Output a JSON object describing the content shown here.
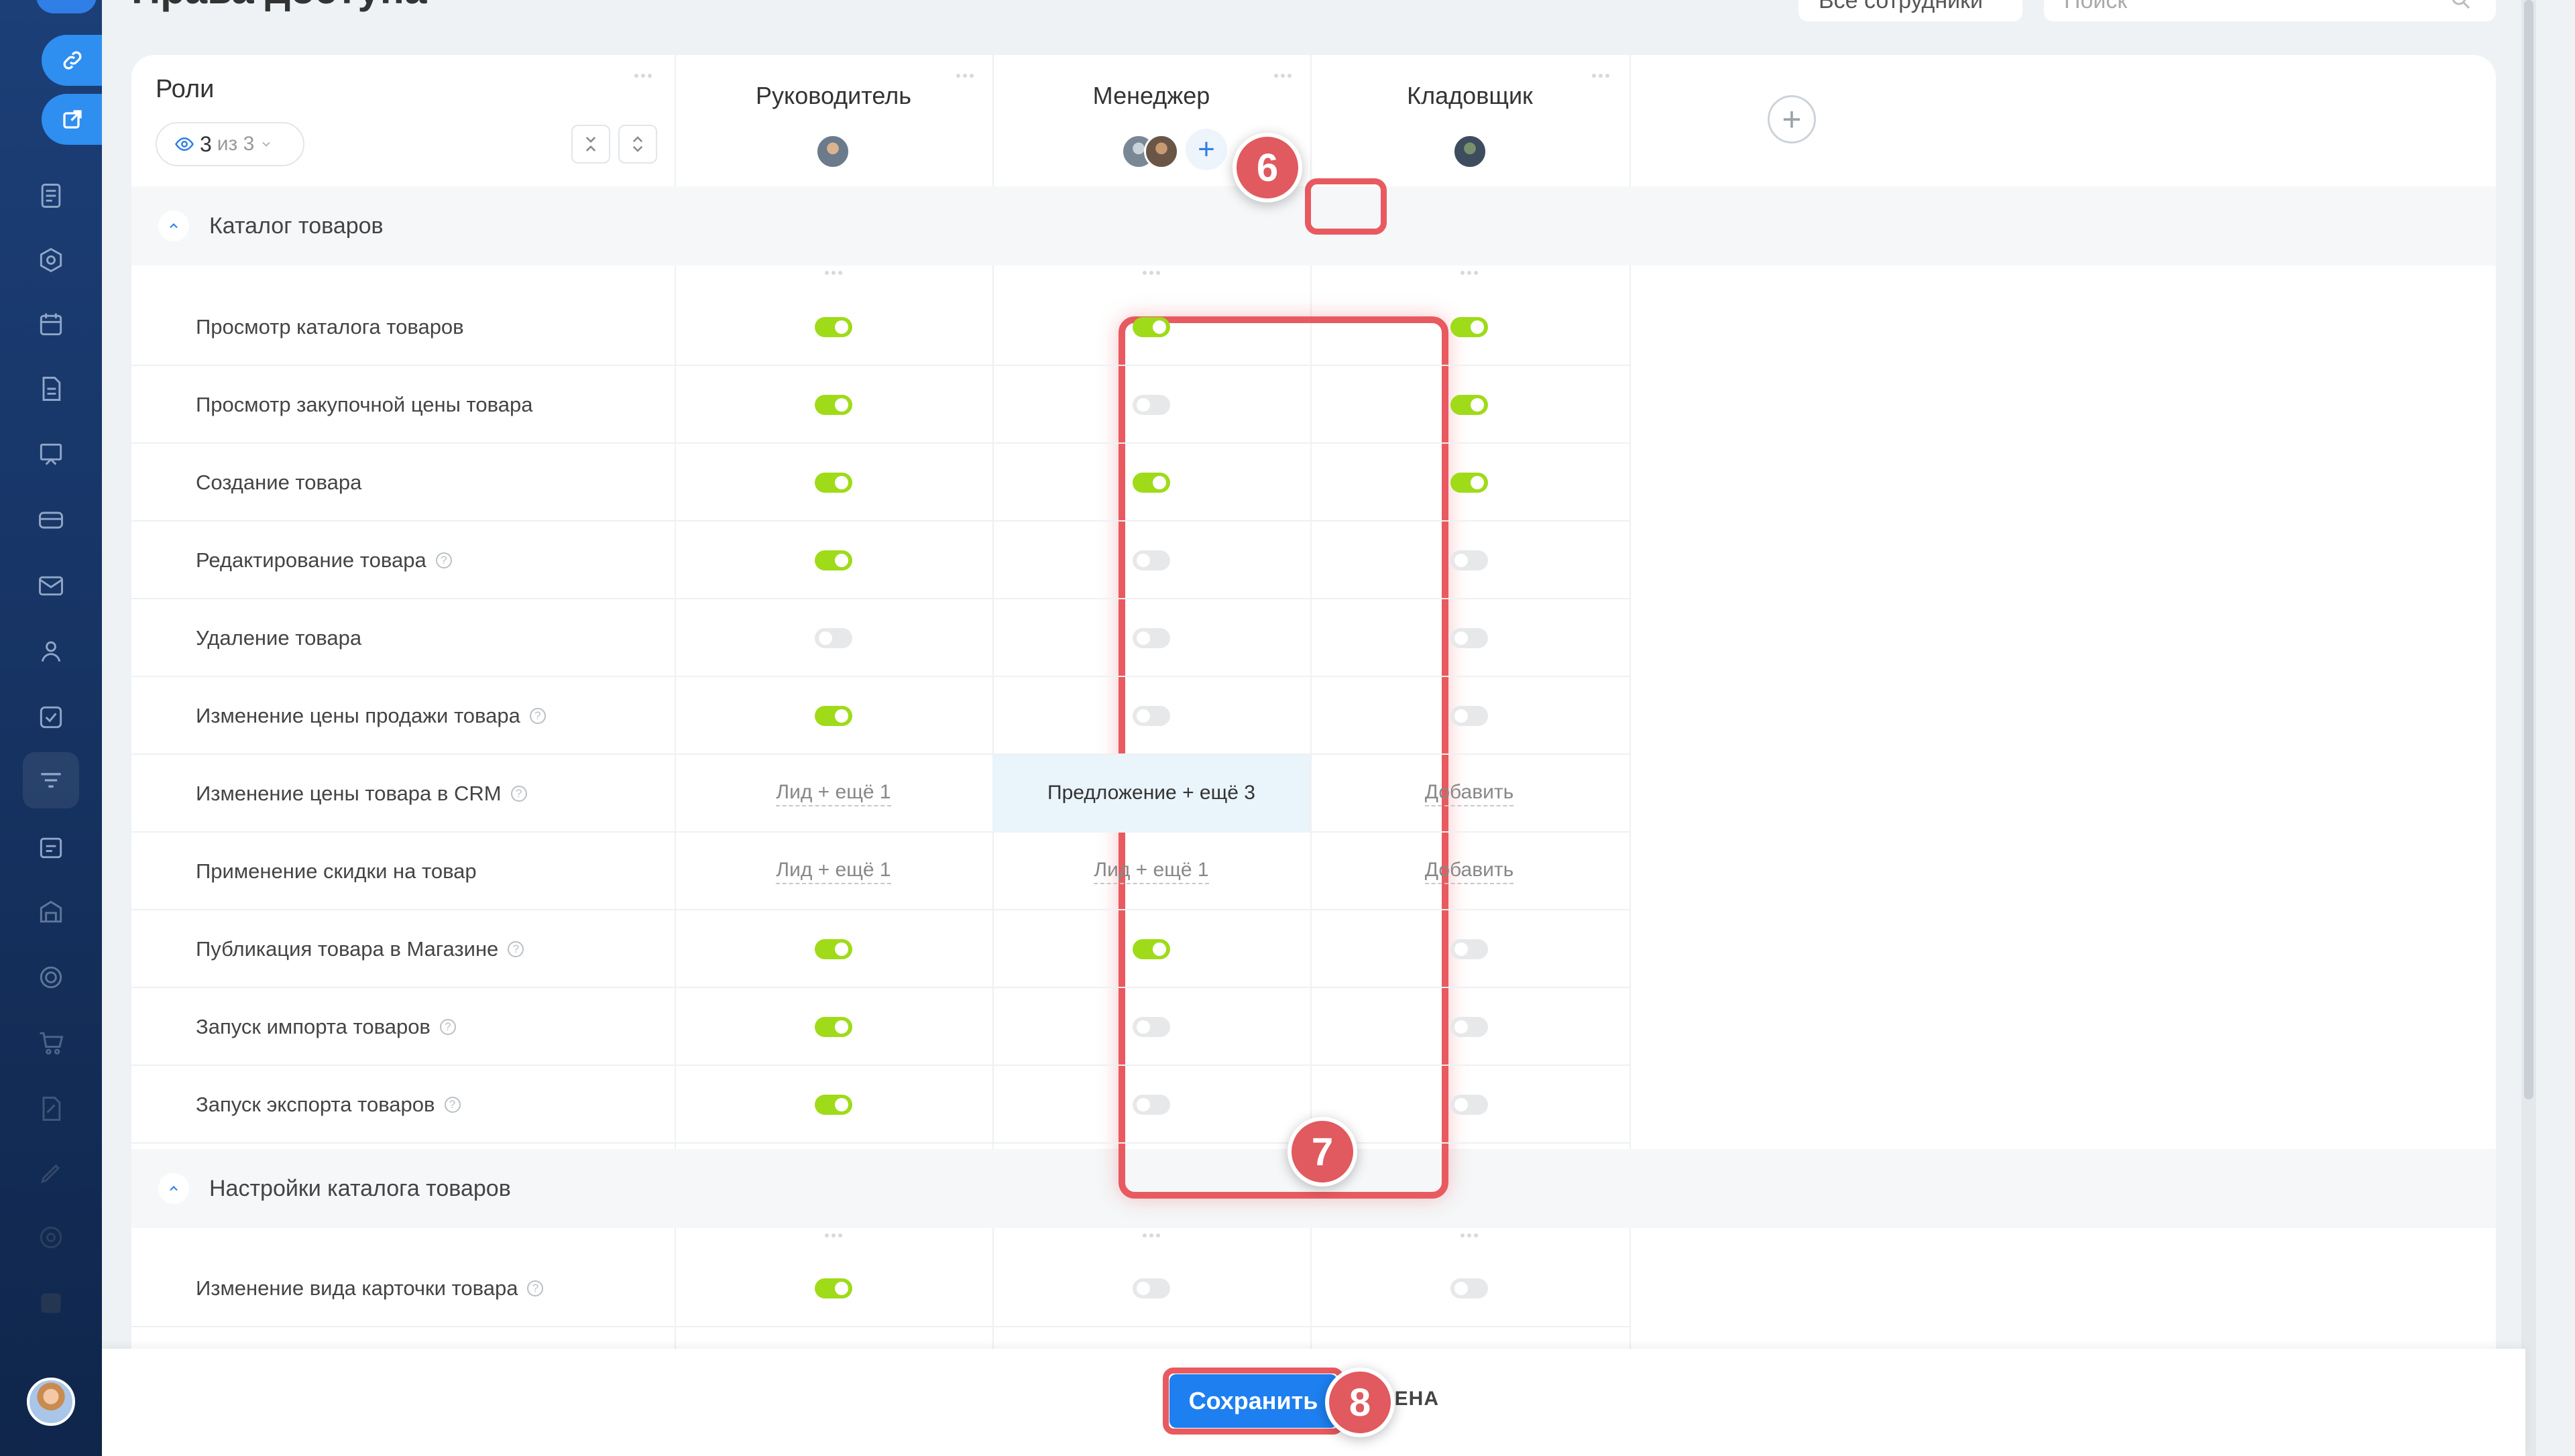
{
  "page": {
    "title": "Права доступа",
    "filter_label": "Все сотрудники",
    "search_placeholder": "Поиск"
  },
  "roles_header": {
    "label": "Роли",
    "counter_value": "3",
    "counter_suffix": "из 3"
  },
  "columns": [
    {
      "label": "Руководитель"
    },
    {
      "label": "Менеджер"
    },
    {
      "label": "Кладовщик"
    }
  ],
  "sections": [
    {
      "label": "Каталог товаров"
    },
    {
      "label": "Настройки каталога товаров"
    }
  ],
  "rows": [
    {
      "name": "Просмотр каталога товаров",
      "help": false,
      "cells": [
        "on",
        "on",
        "on"
      ]
    },
    {
      "name": "Просмотр закупочной цены товара",
      "help": false,
      "cells": [
        "on",
        "off",
        "on"
      ]
    },
    {
      "name": "Создание товара",
      "help": false,
      "cells": [
        "on",
        "on",
        "on"
      ]
    },
    {
      "name": "Редактирование товара",
      "help": true,
      "cells": [
        "on",
        "off",
        "off"
      ]
    },
    {
      "name": "Удаление товара",
      "help": false,
      "cells": [
        "off",
        "off",
        "off"
      ]
    },
    {
      "name": "Изменение цены продажи товара",
      "help": true,
      "cells": [
        "on",
        "off",
        "off"
      ]
    },
    {
      "name": "Изменение цены товара в CRM",
      "help": true,
      "cells": [
        "Лид + ещё 1",
        "Предложение + ещё 3",
        "Добавить"
      ]
    },
    {
      "name": "Применение скидки на товар",
      "help": false,
      "cells": [
        "Лид + ещё 1",
        "Лид + ещё 1",
        "Добавить"
      ]
    },
    {
      "name": "Публикация товара в Магазине",
      "help": true,
      "cells": [
        "on",
        "on",
        "off"
      ]
    },
    {
      "name": "Запуск импорта товаров",
      "help": true,
      "cells": [
        "on",
        "off",
        "off"
      ]
    },
    {
      "name": "Запуск экспорта товаров",
      "help": true,
      "cells": [
        "on",
        "off",
        "off"
      ]
    },
    {
      "name": "Изменение вида карточки товара",
      "help": true,
      "cells": [
        "on",
        "off",
        "off"
      ]
    }
  ],
  "markers": {
    "m6": "6",
    "m7": "7",
    "m8": "8"
  },
  "footer": {
    "save_label": "Сохранить",
    "cancel_label": "ОТМЕНА"
  },
  "colors": {
    "accent": "#1e7ff0",
    "toggle_on": "#9fdb18",
    "marker": "#e05a5f",
    "sidebar": "#1c3f78"
  },
  "icons": {
    "add_user": "+",
    "add_role": "+"
  }
}
